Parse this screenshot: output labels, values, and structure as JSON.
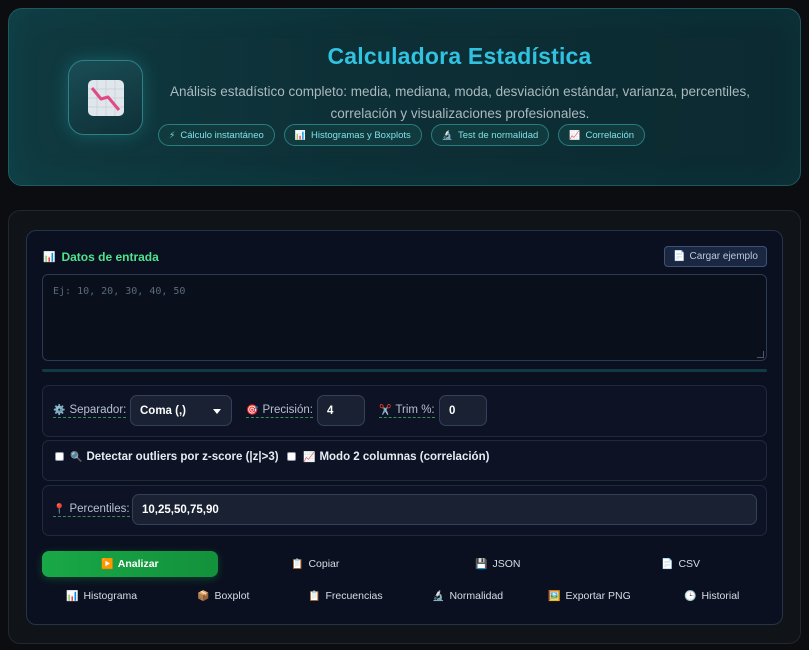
{
  "header": {
    "title": "Calculadora Estadística",
    "subtitle": "Análisis estadístico completo: media, mediana, moda, desviación estándar, varianza, percentiles, correlación y visualizaciones profesionales.",
    "badges": [
      {
        "icon": "⚡",
        "label": "Cálculo instantáneo"
      },
      {
        "icon": "📊",
        "label": "Histogramas y Boxplots"
      },
      {
        "icon": "🔬",
        "label": "Test de normalidad"
      },
      {
        "icon": "📈",
        "label": "Correlación"
      }
    ]
  },
  "input": {
    "label": "Datos de entrada",
    "example_button": "Cargar ejemplo",
    "placeholder": "Ej: 10, 20, 30, 40, 50"
  },
  "options": {
    "separator_label": "Separador:",
    "separator_value": "Coma (,)",
    "precision_label": "Precisión:",
    "precision_value": "4",
    "trim_label": "Trim %:",
    "trim_value": "0",
    "outliers_label": "Detectar outliers por z-score (|z|>3)",
    "two_col_label": "Modo 2 columnas (correlación)",
    "percentiles_label": "Percentiles:",
    "percentiles_value": "10,25,50,75,90"
  },
  "actions": {
    "analyze": "Analizar",
    "copy": "Copiar",
    "json": "JSON",
    "csv": "CSV",
    "histogram": "Histograma",
    "boxplot": "Boxplot",
    "frequencies": "Frecuencias",
    "normality": "Normalidad",
    "export_png": "Exportar PNG",
    "history": "Historial"
  },
  "colors": {
    "accent": "#30c2e0",
    "success": "#18a847",
    "label": "#4ee38c"
  }
}
